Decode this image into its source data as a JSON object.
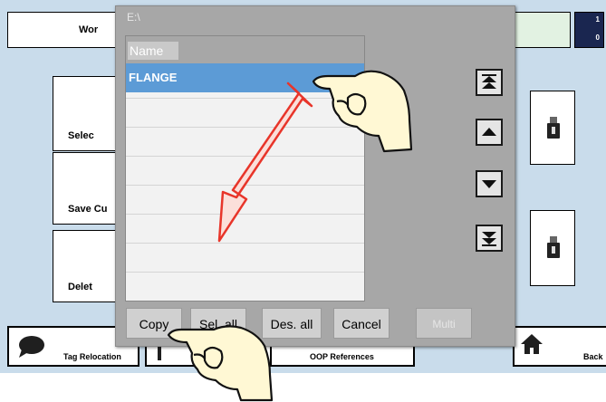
{
  "background": {
    "header_tile_label": "Wor",
    "indicator_digits": [
      "1",
      "0"
    ],
    "side_buttons": [
      "Selec",
      "Save Cu",
      "Delet"
    ],
    "bottom_tiles": {
      "tag_relocation": "Tag Relocation",
      "t_letter": "T",
      "oop_references": "OOP References",
      "back": "Back"
    }
  },
  "dialog": {
    "path": "E:\\",
    "column_header": "Name",
    "items": [
      "FLANGE"
    ],
    "buttons": {
      "copy": "Copy",
      "select_all": "Sel. all",
      "deselect_all": "Des. all",
      "cancel": "Cancel",
      "multi": "Multi"
    }
  },
  "colors": {
    "background": "#c9dceb",
    "dialog": "#a7a7a7",
    "selection": "#5c9bd6",
    "arrow": "#e8352a"
  }
}
